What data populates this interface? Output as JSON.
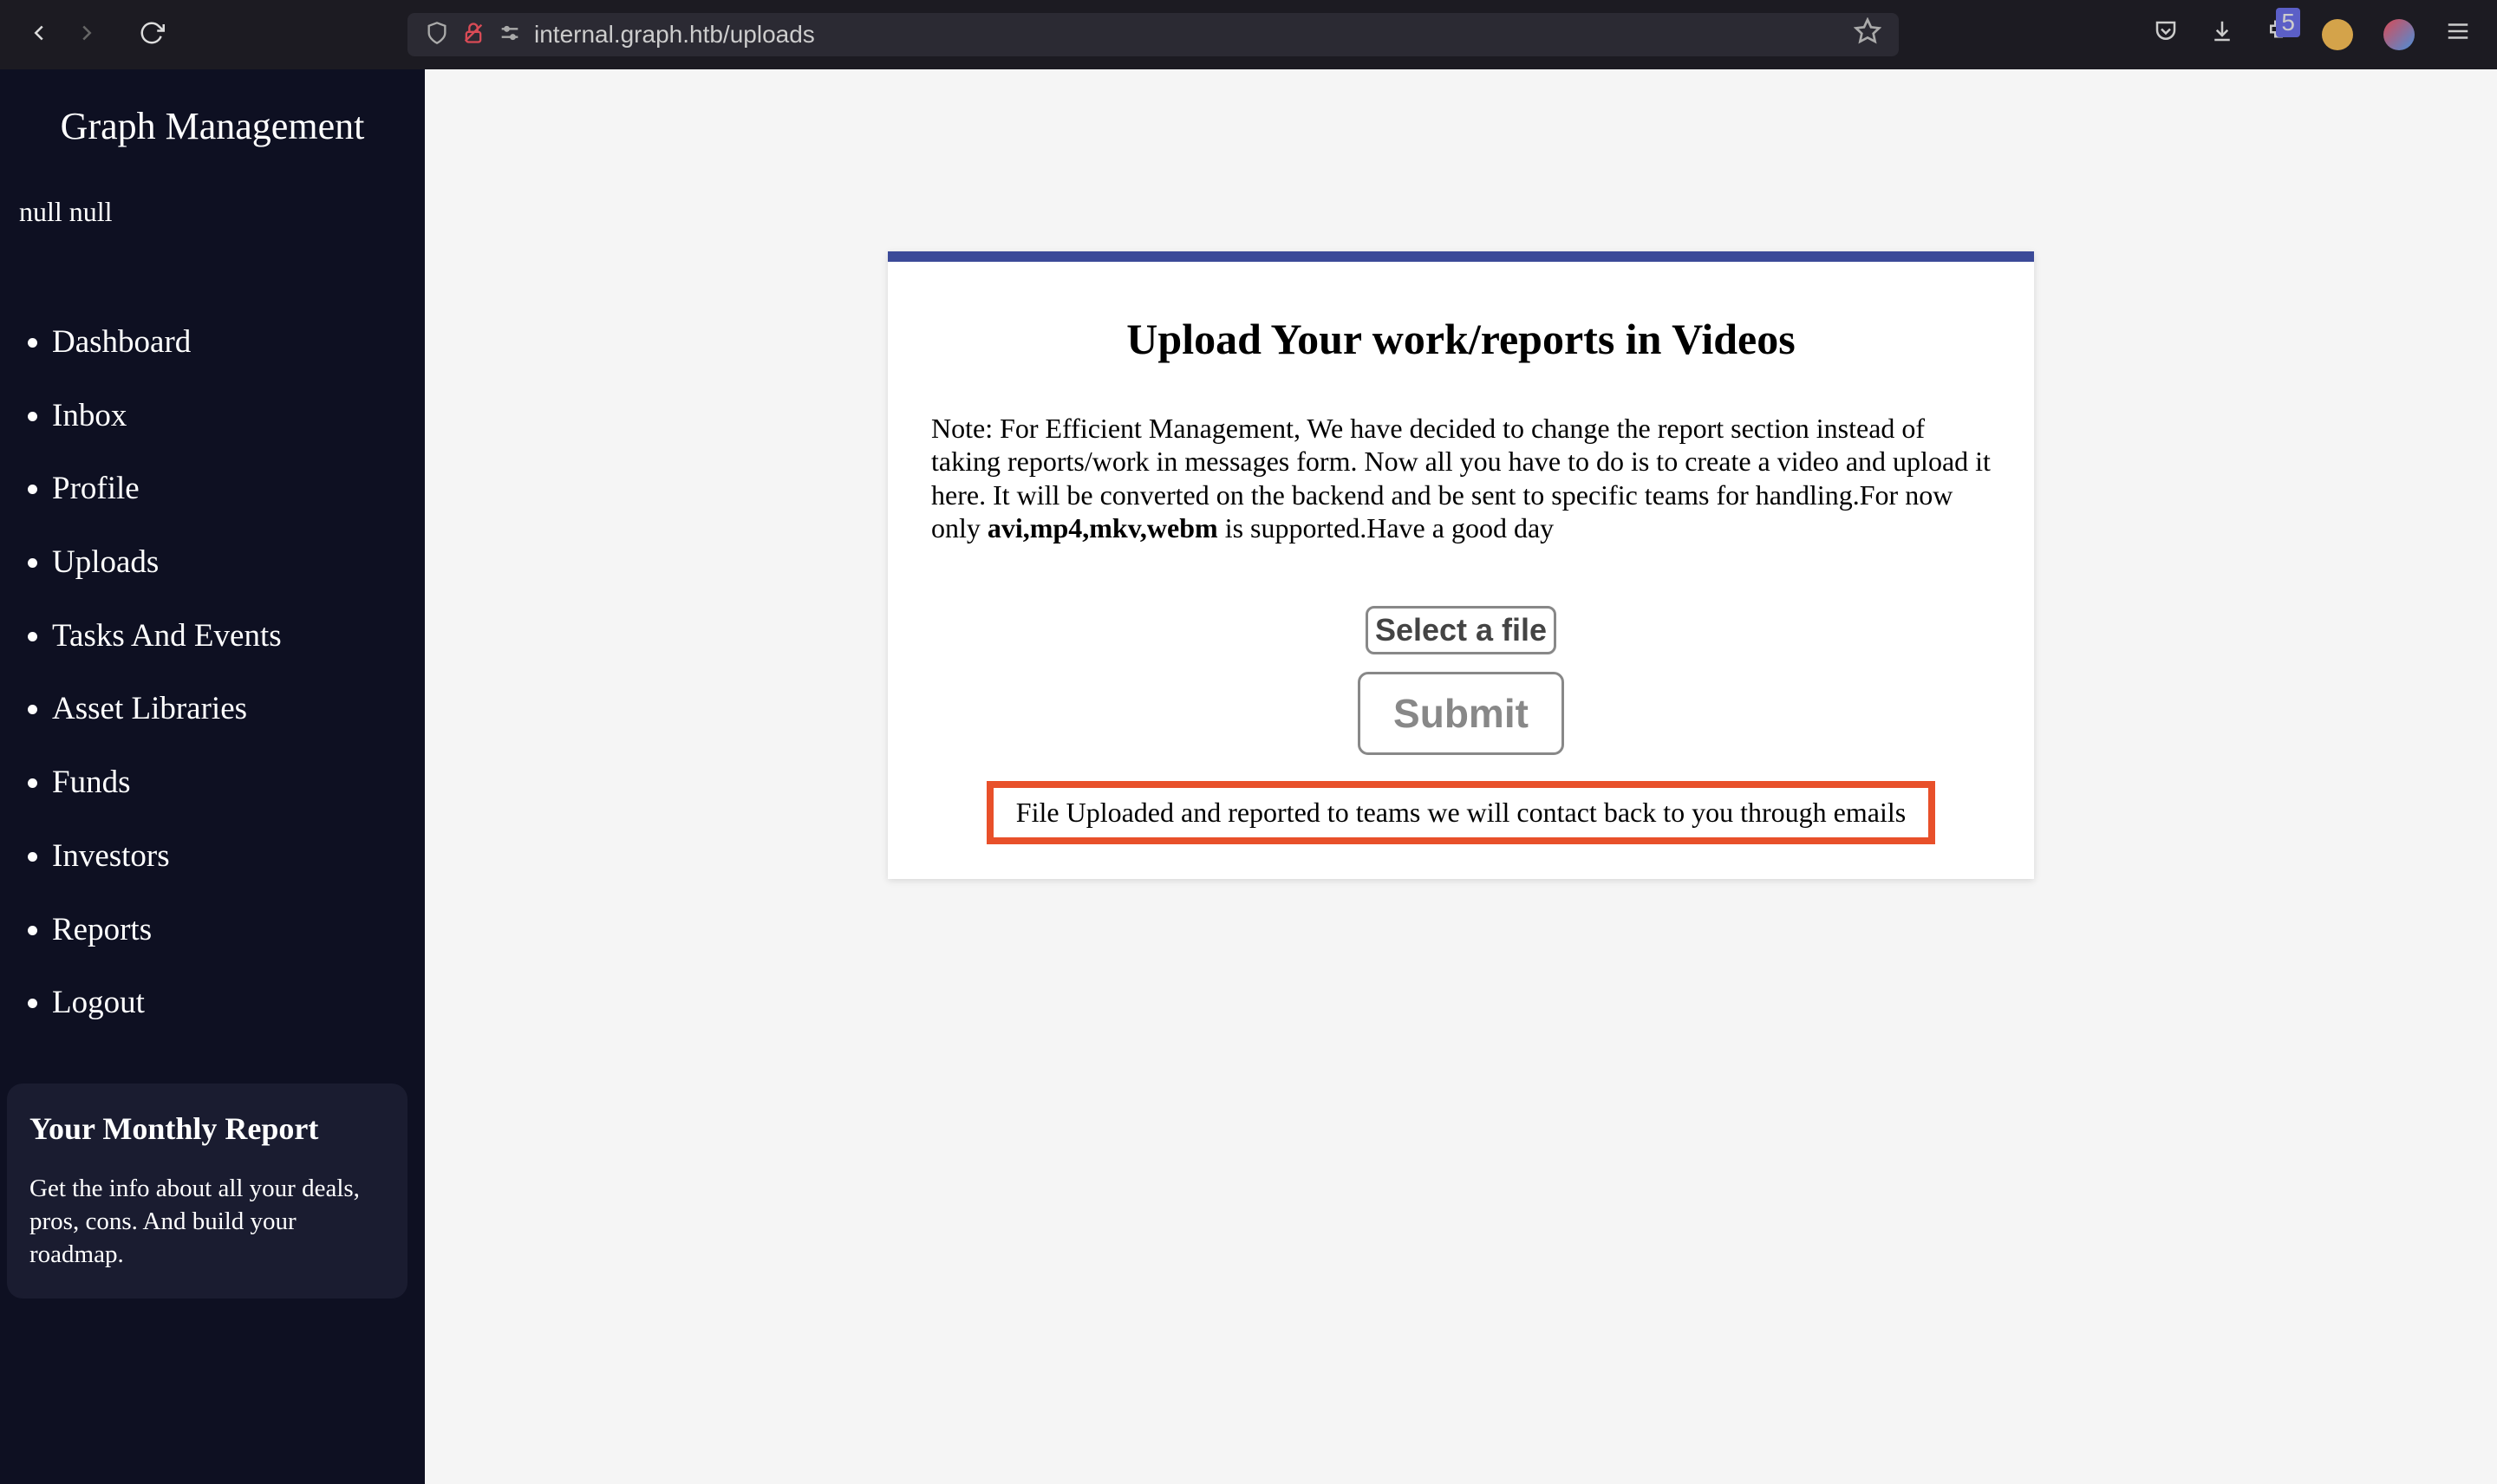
{
  "browser": {
    "url": "internal.graph.htb/uploads",
    "badge_count": "5"
  },
  "sidebar": {
    "title": "Graph Management",
    "user_label": "null null",
    "items": [
      {
        "label": "Dashboard"
      },
      {
        "label": "Inbox"
      },
      {
        "label": "Profile"
      },
      {
        "label": "Uploads"
      },
      {
        "label": "Tasks And Events"
      },
      {
        "label": "Asset Libraries"
      },
      {
        "label": "Funds"
      },
      {
        "label": "Investors"
      },
      {
        "label": "Reports"
      },
      {
        "label": "Logout"
      }
    ],
    "report_card": {
      "title": "Your Monthly Report",
      "body": "Get the info about all your deals, pros, cons. And build your roadmap."
    }
  },
  "upload": {
    "title": "Upload Your work/reports in Videos",
    "note_prefix": "Note: For Efficient Management, We have decided to change the report section instead of taking reports/work in messages form. Now all you have to do is to create a video and upload it here. It will be converted on the backend and be sent to specific teams for handling.For now only ",
    "note_formats": "avi,mp4,mkv,webm",
    "note_suffix": " is supported.Have a good day",
    "select_label": "Select a file",
    "submit_label": "Submit",
    "status_message": "File Uploaded and reported to teams we will contact back to you through emails"
  }
}
